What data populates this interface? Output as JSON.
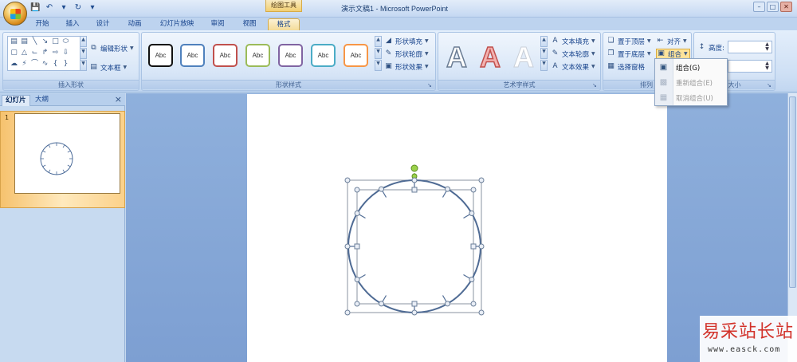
{
  "window": {
    "title": "演示文稿1 - Microsoft PowerPoint",
    "context_tool": "绘图工具"
  },
  "tabs": [
    "开始",
    "插入",
    "设计",
    "动画",
    "幻灯片放映",
    "审阅",
    "视图",
    "格式"
  ],
  "active_tab": "格式",
  "ribbon": {
    "insert_shapes": {
      "label": "插入形状",
      "edit_shape": "编辑形状",
      "text_box": "文本框"
    },
    "shape_styles": {
      "label": "形状样式",
      "style_sample": "Abc",
      "style_colors": [
        "#111111",
        "#4f81bd",
        "#c0504d",
        "#9bbb59",
        "#8064a2",
        "#4bacc6",
        "#f79646"
      ],
      "fill": "形状填充",
      "outline": "形状轮廓",
      "effects": "形状效果"
    },
    "wordart": {
      "label": "艺术字样式",
      "sample": "A",
      "text_fill": "文本填充",
      "text_outline": "文本轮廓",
      "text_effects": "文本效果"
    },
    "arrange": {
      "label": "排列",
      "bring_front": "置于顶层",
      "send_back": "置于底层",
      "selection_pane": "选择窗格",
      "align": "对齐",
      "group": "组合"
    },
    "size": {
      "label": "大小",
      "height_label": "高度:"
    }
  },
  "group_menu": {
    "items": [
      {
        "label": "组合(G)",
        "icon": "group-icon",
        "enabled": true
      },
      {
        "label": "重新组合(E)",
        "icon": "regroup-icon",
        "enabled": false
      },
      {
        "label": "取消组合(U)",
        "icon": "ungroup-icon",
        "enabled": false
      }
    ]
  },
  "left_pane": {
    "tabs": [
      "幻灯片",
      "大纲"
    ],
    "close": "×",
    "slide_number": "1"
  },
  "watermark": {
    "title": "易采站长站",
    "url": "www.easck.com"
  }
}
